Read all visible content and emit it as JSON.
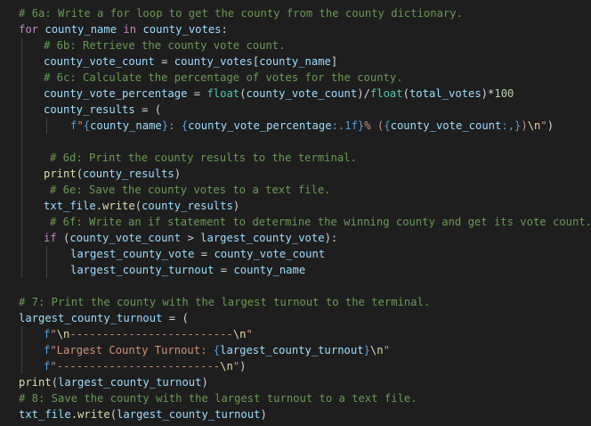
{
  "editor": {
    "lines": [
      {
        "indent": 0,
        "guides": 0,
        "tokens": [
          {
            "t": "c",
            "v": "# 6a: Write a for loop to get the county from the county dictionary."
          }
        ]
      },
      {
        "indent": 0,
        "guides": 0,
        "tokens": [
          {
            "t": "k",
            "v": "for"
          },
          {
            "t": "p",
            "v": " "
          },
          {
            "t": "v",
            "v": "county_name"
          },
          {
            "t": "p",
            "v": " "
          },
          {
            "t": "k",
            "v": "in"
          },
          {
            "t": "p",
            "v": " "
          },
          {
            "t": "v",
            "v": "county_votes"
          },
          {
            "t": "p",
            "v": ":"
          }
        ]
      },
      {
        "indent": 1,
        "guides": 1,
        "tokens": [
          {
            "t": "c",
            "v": "# 6b: Retrieve the county vote count."
          }
        ]
      },
      {
        "indent": 1,
        "guides": 1,
        "tokens": [
          {
            "t": "v",
            "v": "county_vote_count"
          },
          {
            "t": "p",
            "v": " = "
          },
          {
            "t": "v",
            "v": "county_votes"
          },
          {
            "t": "p",
            "v": "["
          },
          {
            "t": "v",
            "v": "county_name"
          },
          {
            "t": "p",
            "v": "]"
          }
        ]
      },
      {
        "indent": 1,
        "guides": 1,
        "tokens": [
          {
            "t": "c",
            "v": "# 6c: Calculate the percentage of votes for the county."
          }
        ]
      },
      {
        "indent": 1,
        "guides": 1,
        "tokens": [
          {
            "t": "v",
            "v": "county_vote_percentage"
          },
          {
            "t": "p",
            "v": " = "
          },
          {
            "t": "fn",
            "v": "float"
          },
          {
            "t": "p",
            "v": "("
          },
          {
            "t": "v",
            "v": "county_vote_count"
          },
          {
            "t": "p",
            "v": ")/"
          },
          {
            "t": "fn",
            "v": "float"
          },
          {
            "t": "p",
            "v": "("
          },
          {
            "t": "v",
            "v": "total_votes"
          },
          {
            "t": "p",
            "v": ")*"
          },
          {
            "t": "n",
            "v": "100"
          }
        ]
      },
      {
        "indent": 1,
        "guides": 1,
        "tokens": [
          {
            "t": "v",
            "v": "county_results"
          },
          {
            "t": "p",
            "v": " = ("
          }
        ]
      },
      {
        "indent": 2,
        "guides": 2,
        "tokens": [
          {
            "t": "b",
            "v": "f"
          },
          {
            "t": "s",
            "v": "\""
          },
          {
            "t": "b",
            "v": "{"
          },
          {
            "t": "v",
            "v": "county_name"
          },
          {
            "t": "b",
            "v": "}"
          },
          {
            "t": "s",
            "v": ": "
          },
          {
            "t": "b",
            "v": "{"
          },
          {
            "t": "v",
            "v": "county_vote_percentage"
          },
          {
            "t": "b",
            "v": ":.1f}"
          },
          {
            "t": "s",
            "v": "% ("
          },
          {
            "t": "b",
            "v": "{"
          },
          {
            "t": "v",
            "v": "county_vote_count"
          },
          {
            "t": "b",
            "v": ":,}"
          },
          {
            "t": "s",
            "v": ")"
          },
          {
            "t": "f",
            "v": "\\n"
          },
          {
            "t": "s",
            "v": "\""
          },
          {
            "t": "p",
            "v": ")"
          }
        ]
      },
      {
        "indent": 1,
        "guides": 1,
        "tokens": []
      },
      {
        "indent": 3,
        "guides": 1,
        "tokens": [
          {
            "t": "c",
            "v": "# 6d: Print the county results to the terminal."
          }
        ]
      },
      {
        "indent": 1,
        "guides": 1,
        "tokens": [
          {
            "t": "f",
            "v": "print"
          },
          {
            "t": "p",
            "v": "("
          },
          {
            "t": "v",
            "v": "county_results"
          },
          {
            "t": "p",
            "v": ")"
          }
        ]
      },
      {
        "indent": 3,
        "guides": 1,
        "tokens": [
          {
            "t": "c",
            "v": "# 6e: Save the county votes to a text file."
          }
        ]
      },
      {
        "indent": 1,
        "guides": 1,
        "tokens": [
          {
            "t": "v",
            "v": "txt_file"
          },
          {
            "t": "p",
            "v": "."
          },
          {
            "t": "f",
            "v": "write"
          },
          {
            "t": "p",
            "v": "("
          },
          {
            "t": "v",
            "v": "county_results"
          },
          {
            "t": "p",
            "v": ")"
          }
        ]
      },
      {
        "indent": 3,
        "guides": 1,
        "tokens": [
          {
            "t": "c",
            "v": "# 6f: Write an if statement to determine the winning county and get its vote count."
          }
        ]
      },
      {
        "indent": 1,
        "guides": 1,
        "tokens": [
          {
            "t": "k",
            "v": "if"
          },
          {
            "t": "p",
            "v": " ("
          },
          {
            "t": "v",
            "v": "county_vote_count"
          },
          {
            "t": "p",
            "v": " > "
          },
          {
            "t": "v",
            "v": "largest_county_vote"
          },
          {
            "t": "p",
            "v": "):"
          }
        ]
      },
      {
        "indent": 2,
        "guides": 2,
        "tokens": [
          {
            "t": "v",
            "v": "largest_county_vote"
          },
          {
            "t": "p",
            "v": " = "
          },
          {
            "t": "v",
            "v": "county_vote_count"
          }
        ]
      },
      {
        "indent": 2,
        "guides": 2,
        "tokens": [
          {
            "t": "v",
            "v": "largest_county_turnout"
          },
          {
            "t": "p",
            "v": " = "
          },
          {
            "t": "v",
            "v": "county_name"
          }
        ]
      },
      {
        "indent": 0,
        "guides": 0,
        "tokens": []
      },
      {
        "indent": 0,
        "guides": 0,
        "tokens": [
          {
            "t": "c",
            "v": "# 7: Print the county with the largest turnout to the terminal."
          }
        ]
      },
      {
        "indent": 0,
        "guides": 0,
        "tokens": [
          {
            "t": "v",
            "v": "largest_county_turnout"
          },
          {
            "t": "p",
            "v": " = ("
          }
        ]
      },
      {
        "indent": 1,
        "guides": 1,
        "tokens": [
          {
            "t": "b",
            "v": "f"
          },
          {
            "t": "s",
            "v": "\""
          },
          {
            "t": "f",
            "v": "\\n"
          },
          {
            "t": "s",
            "v": "-------------------------"
          },
          {
            "t": "f",
            "v": "\\n"
          },
          {
            "t": "s",
            "v": "\""
          }
        ]
      },
      {
        "indent": 1,
        "guides": 1,
        "tokens": [
          {
            "t": "b",
            "v": "f"
          },
          {
            "t": "s",
            "v": "\"Largest County Turnout: "
          },
          {
            "t": "b",
            "v": "{"
          },
          {
            "t": "v",
            "v": "largest_county_turnout"
          },
          {
            "t": "b",
            "v": "}"
          },
          {
            "t": "f",
            "v": "\\n"
          },
          {
            "t": "s",
            "v": "\""
          }
        ]
      },
      {
        "indent": 1,
        "guides": 1,
        "tokens": [
          {
            "t": "b",
            "v": "f"
          },
          {
            "t": "s",
            "v": "\"-------------------------"
          },
          {
            "t": "f",
            "v": "\\n"
          },
          {
            "t": "s",
            "v": "\""
          },
          {
            "t": "p",
            "v": ")"
          }
        ]
      },
      {
        "indent": 0,
        "guides": 0,
        "tokens": [
          {
            "t": "f",
            "v": "print"
          },
          {
            "t": "p",
            "v": "("
          },
          {
            "t": "v",
            "v": "largest_county_turnout"
          },
          {
            "t": "p",
            "v": ")"
          }
        ]
      },
      {
        "indent": 0,
        "guides": 0,
        "tokens": [
          {
            "t": "c",
            "v": "# 8: Save the county with the largest turnout to a text file."
          }
        ]
      },
      {
        "indent": 0,
        "guides": 0,
        "tokens": [
          {
            "t": "v",
            "v": "txt_file"
          },
          {
            "t": "p",
            "v": "."
          },
          {
            "t": "f",
            "v": "write"
          },
          {
            "t": "p",
            "v": "("
          },
          {
            "t": "v",
            "v": "largest_county_turnout"
          },
          {
            "t": "p",
            "v": ")"
          }
        ]
      }
    ]
  }
}
